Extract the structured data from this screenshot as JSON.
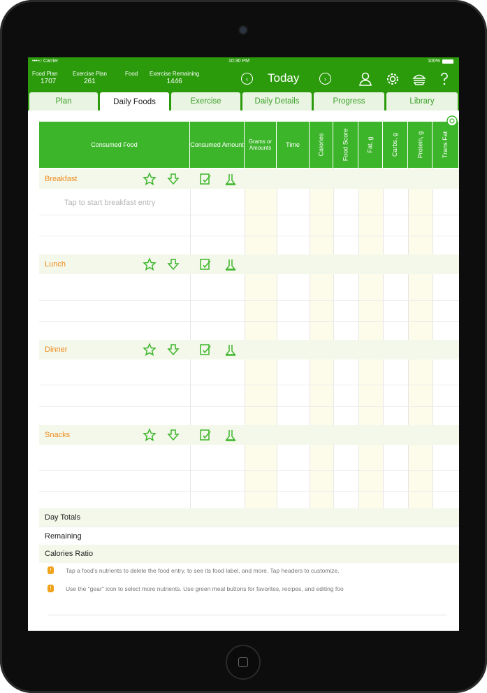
{
  "status": {
    "carrier": "••••○ Carrier",
    "time": "10:30 PM",
    "battery": "100%"
  },
  "header": {
    "stats": [
      {
        "label": "Food Plan",
        "value": "1707"
      },
      {
        "label": "Exercise Plan",
        "value": "261"
      },
      {
        "label": "Food",
        "value": ""
      },
      {
        "label": "Exercise Remaining",
        "value": "1446"
      }
    ],
    "title": "Today",
    "icons": [
      "prev-day-icon",
      "next-day-icon",
      "profile-icon",
      "gear-icon",
      "food-icon",
      "help-icon"
    ]
  },
  "tabs": [
    "Plan",
    "Daily Foods",
    "Exercise",
    "Daily Details",
    "Progress",
    "Library"
  ],
  "active_tab": "Daily Foods",
  "table": {
    "columns": [
      "Consumed Food",
      "Consumed Amount",
      "Grams or Amounts",
      "Time",
      "Calories",
      "Food Score",
      "Fat, g",
      "Carbs, g",
      "Protein, g",
      "Trans Fat"
    ],
    "meals": [
      {
        "label": "Breakfast",
        "placeholder": "Tap to start breakfast entry"
      },
      {
        "label": "Lunch",
        "placeholder": ""
      },
      {
        "label": "Dinner",
        "placeholder": ""
      },
      {
        "label": "Snacks",
        "placeholder": ""
      }
    ]
  },
  "totals": [
    "Day Totals",
    "Remaining",
    "Calories Ratio"
  ],
  "tips": [
    "Tap a food's nutrients to delete the food entry, to see its food label, and more. Tap headers to customize.",
    "Use the \"gear\" icon to select more nutrients. Use green meal buttons for favorites, recipes, and editing foo"
  ],
  "colors": {
    "brand_green": "#2b9b0c",
    "header_green": "#3cb52a",
    "meal_orange": "#f08a1c"
  }
}
